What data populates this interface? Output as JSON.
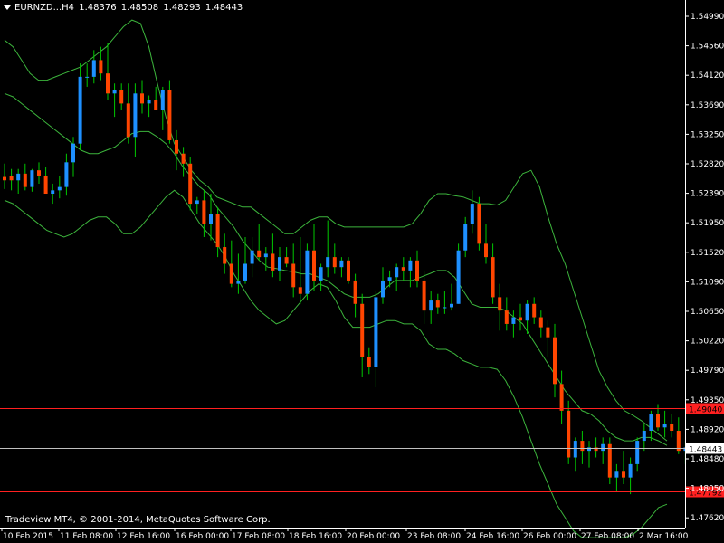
{
  "header": {
    "symbol": "EURNZD...H4",
    "open": "1.48376",
    "high": "1.48508",
    "low": "1.48293",
    "close": "1.48443"
  },
  "copyright": "Tradeview MT4, © 2001-2014, MetaQuotes Software Corp.",
  "colors": {
    "background": "#000000",
    "bull": "#1e90ff",
    "bear": "#ff4500",
    "wick": "#00c800",
    "bands": "#3cb43c",
    "hline": "#ff2020",
    "bidline": "#c0c0c0",
    "text": "#ffffff"
  },
  "chart_data": {
    "type": "candlestick",
    "ylim": [
      1.4725,
      1.5515
    ],
    "y_ticks": [
      "1.54990",
      "1.54560",
      "1.54120",
      "1.53690",
      "1.53250",
      "1.52820",
      "1.52390",
      "1.51950",
      "1.51520",
      "1.51090",
      "1.50650",
      "1.50220",
      "1.49790",
      "1.49350",
      "1.48920",
      "1.48480",
      "1.48050",
      "1.47620"
    ],
    "x_labels": [
      "10 Feb 2015",
      "11 Feb 08:00",
      "12 Feb 16:00",
      "16 Feb 00:00",
      "17 Feb 08:00",
      "18 Feb 16:00",
      "20 Feb 00:00",
      "23 Feb 08:00",
      "24 Feb 16:00",
      "26 Feb 00:00",
      "27 Feb 08:00",
      "2 Mar 16:00"
    ],
    "horizontal_levels": [
      {
        "price": 1.4904,
        "label": "1.49040",
        "color": "#ff2020"
      },
      {
        "price": 1.47792,
        "label": "1.47792",
        "color": "#ff2020"
      }
    ],
    "bid": {
      "price": 1.48443,
      "label": "1.48443"
    },
    "indicator": "Bollinger Bands",
    "bands": {
      "upper": [
        1.5455,
        1.5445,
        1.5425,
        1.5405,
        1.5395,
        1.5395,
        1.54,
        1.5405,
        1.541,
        1.5415,
        1.5425,
        1.5435,
        1.5445,
        1.546,
        1.5475,
        1.5485,
        1.548,
        1.5445,
        1.539,
        1.534,
        1.53,
        1.528,
        1.526,
        1.5245,
        1.5235,
        1.522,
        1.5215,
        1.521,
        1.5205,
        1.5205,
        1.5195,
        1.5185,
        1.5175,
        1.5165,
        1.5165,
        1.5175,
        1.5185,
        1.519,
        1.519,
        1.518,
        1.5175,
        1.5175,
        1.5175,
        1.5175,
        1.5175,
        1.5175,
        1.5175,
        1.5175,
        1.518,
        1.5195,
        1.5215,
        1.5225,
        1.5225,
        1.5222,
        1.522,
        1.5215,
        1.521,
        1.521,
        1.5208,
        1.5215,
        1.5235,
        1.5255,
        1.526,
        1.5235,
        1.519,
        1.515,
        1.512,
        1.508,
        1.504,
        1.5,
        1.496,
        1.4935,
        1.4915,
        1.49,
        1.4893,
        1.4885,
        1.4875,
        1.4865,
        1.4855
      ],
      "middle": [
        1.5375,
        1.537,
        1.536,
        1.535,
        1.534,
        1.533,
        1.532,
        1.531,
        1.53,
        1.529,
        1.5285,
        1.5285,
        1.529,
        1.5295,
        1.5305,
        1.5315,
        1.5318,
        1.5318,
        1.531,
        1.53,
        1.5285,
        1.5265,
        1.525,
        1.5235,
        1.5225,
        1.5205,
        1.519,
        1.5175,
        1.5155,
        1.514,
        1.5125,
        1.5115,
        1.5113,
        1.511,
        1.5108,
        1.5105,
        1.5105,
        1.51,
        1.5095,
        1.5085,
        1.5075,
        1.507,
        1.507,
        1.507,
        1.5075,
        1.5085,
        1.5095,
        1.5095,
        1.5095,
        1.51,
        1.5105,
        1.511,
        1.511,
        1.51,
        1.508,
        1.506,
        1.5055,
        1.5055,
        1.5055,
        1.505,
        1.504,
        1.503,
        1.501,
        1.499,
        1.497,
        1.495,
        1.493,
        1.4915,
        1.49,
        1.4895,
        1.4885,
        1.487,
        1.486,
        1.4855,
        1.4855,
        1.486,
        1.486,
        1.4855,
        1.4848
      ],
      "lower": [
        1.5215,
        1.521,
        1.52,
        1.519,
        1.518,
        1.517,
        1.5165,
        1.516,
        1.5165,
        1.5175,
        1.5185,
        1.519,
        1.519,
        1.518,
        1.5165,
        1.5165,
        1.5175,
        1.519,
        1.5205,
        1.522,
        1.523,
        1.522,
        1.52,
        1.518,
        1.5165,
        1.515,
        1.513,
        1.5105,
        1.5085,
        1.5065,
        1.505,
        1.504,
        1.503,
        1.5035,
        1.505,
        1.5065,
        1.508,
        1.509,
        1.5085,
        1.5065,
        1.504,
        1.5025,
        1.5025,
        1.5025,
        1.503,
        1.5035,
        1.5035,
        1.503,
        1.503,
        1.502,
        1.5,
        1.4992,
        1.4992,
        1.4985,
        1.4975,
        1.497,
        1.4965,
        1.4965,
        1.4962,
        1.4945,
        1.492,
        1.489,
        1.4855,
        1.482,
        1.479,
        1.476,
        1.474,
        1.472,
        1.471,
        1.471,
        1.471,
        1.471,
        1.471,
        1.471,
        1.4715,
        1.4725,
        1.474,
        1.4755,
        1.476
      ],
      "_note": "band values sampled uniformly across x"
    },
    "candles": [
      [
        1.525,
        1.527,
        1.5232,
        1.5245
      ],
      [
        1.5252,
        1.5262,
        1.523,
        1.5245
      ],
      [
        1.5245,
        1.5262,
        1.5225,
        1.5255
      ],
      [
        1.5255,
        1.527,
        1.523,
        1.5235
      ],
      [
        1.5235,
        1.5262,
        1.5228,
        1.526
      ],
      [
        1.526,
        1.5272,
        1.524,
        1.5252
      ],
      [
        1.5252,
        1.5265,
        1.5225,
        1.5225
      ],
      [
        1.5225,
        1.524,
        1.521,
        1.523
      ],
      [
        1.523,
        1.5252,
        1.5218,
        1.5235
      ],
      [
        1.5235,
        1.5285,
        1.5222,
        1.5272
      ],
      [
        1.5272,
        1.531,
        1.525,
        1.53
      ],
      [
        1.53,
        1.542,
        1.529,
        1.54
      ],
      [
        1.54,
        1.542,
        1.5385,
        1.54
      ],
      [
        1.54,
        1.544,
        1.539,
        1.5425
      ],
      [
        1.5425,
        1.5445,
        1.5395,
        1.5405
      ],
      [
        1.5405,
        1.545,
        1.5365,
        1.5375
      ],
      [
        1.5375,
        1.539,
        1.534,
        1.538
      ],
      [
        1.538,
        1.539,
        1.535,
        1.536
      ],
      [
        1.536,
        1.539,
        1.53,
        1.531
      ],
      [
        1.531,
        1.539,
        1.528,
        1.5375
      ],
      [
        1.5375,
        1.5395,
        1.5345,
        1.536
      ],
      [
        1.536,
        1.5372,
        1.534,
        1.5365
      ],
      [
        1.5365,
        1.5385,
        1.535,
        1.535
      ],
      [
        1.535,
        1.5385,
        1.532,
        1.538
      ],
      [
        1.538,
        1.5395,
        1.53,
        1.5305
      ],
      [
        1.5305,
        1.532,
        1.526,
        1.5285
      ],
      [
        1.5285,
        1.5295,
        1.525,
        1.527
      ],
      [
        1.527,
        1.528,
        1.52,
        1.521
      ],
      [
        1.521,
        1.522,
        1.5195,
        1.5215
      ],
      [
        1.5215,
        1.523,
        1.516,
        1.518
      ],
      [
        1.518,
        1.5225,
        1.5155,
        1.5195
      ],
      [
        1.5195,
        1.5205,
        1.513,
        1.5145
      ],
      [
        1.5145,
        1.5165,
        1.5105,
        1.512
      ],
      [
        1.512,
        1.5155,
        1.5085,
        1.509
      ],
      [
        1.509,
        1.5135,
        1.5075,
        1.5095
      ],
      [
        1.5095,
        1.516,
        1.509,
        1.512
      ],
      [
        1.512,
        1.516,
        1.51,
        1.514
      ],
      [
        1.514,
        1.518,
        1.5125,
        1.513
      ],
      [
        1.513,
        1.5145,
        1.511,
        1.5135
      ],
      [
        1.5135,
        1.5165,
        1.51,
        1.511
      ],
      [
        1.511,
        1.5145,
        1.5095,
        1.513
      ],
      [
        1.513,
        1.5145,
        1.5115,
        1.512
      ],
      [
        1.512,
        1.515,
        1.507,
        1.5085
      ],
      [
        1.5085,
        1.516,
        1.506,
        1.5075
      ],
      [
        1.5075,
        1.515,
        1.5065,
        1.514
      ],
      [
        1.514,
        1.518,
        1.508,
        1.5095
      ],
      [
        1.5095,
        1.512,
        1.508,
        1.5115
      ],
      [
        1.5115,
        1.5185,
        1.51,
        1.513
      ],
      [
        1.513,
        1.515,
        1.5105,
        1.5115
      ],
      [
        1.5115,
        1.513,
        1.51,
        1.5125
      ],
      [
        1.5125,
        1.513,
        1.509,
        1.5095
      ],
      [
        1.5095,
        1.5105,
        1.504,
        1.506
      ],
      [
        1.506,
        1.5075,
        1.495,
        1.498
      ],
      [
        1.498,
        1.4995,
        1.4955,
        1.4965
      ],
      [
        1.4965,
        1.508,
        1.4935,
        1.507
      ],
      [
        1.507,
        1.5115,
        1.506,
        1.5095
      ],
      [
        1.5095,
        1.511,
        1.5085,
        1.51
      ],
      [
        1.51,
        1.512,
        1.508,
        1.5115
      ],
      [
        1.5115,
        1.513,
        1.5095,
        1.511
      ],
      [
        1.511,
        1.513,
        1.5085,
        1.5125
      ],
      [
        1.5125,
        1.514,
        1.5085,
        1.5095
      ],
      [
        1.5095,
        1.511,
        1.503,
        1.505
      ],
      [
        1.505,
        1.508,
        1.503,
        1.5065
      ],
      [
        1.5065,
        1.5075,
        1.5045,
        1.5055
      ],
      [
        1.5055,
        1.508,
        1.5045,
        1.5055
      ],
      [
        1.5055,
        1.509,
        1.505,
        1.506
      ],
      [
        1.506,
        1.515,
        1.506,
        1.514
      ],
      [
        1.514,
        1.519,
        1.513,
        1.518
      ],
      [
        1.518,
        1.523,
        1.5165,
        1.521
      ],
      [
        1.521,
        1.522,
        1.514,
        1.515
      ],
      [
        1.515,
        1.518,
        1.512,
        1.513
      ],
      [
        1.513,
        1.515,
        1.506,
        1.507
      ],
      [
        1.507,
        1.509,
        1.502,
        1.505
      ],
      [
        1.505,
        1.507,
        1.502,
        1.503
      ],
      [
        1.503,
        1.505,
        1.501,
        1.504
      ],
      [
        1.504,
        1.506,
        1.502,
        1.5035
      ],
      [
        1.5035,
        1.5065,
        1.5015,
        1.506
      ],
      [
        1.506,
        1.507,
        1.503,
        1.504
      ],
      [
        1.504,
        1.505,
        1.501,
        1.5025
      ],
      [
        1.5025,
        1.5035,
        1.498,
        1.501
      ],
      [
        1.501,
        1.503,
        1.492,
        1.494
      ],
      [
        1.494,
        1.496,
        1.488,
        1.49
      ],
      [
        1.49,
        1.4915,
        1.482,
        1.483
      ],
      [
        1.483,
        1.486,
        1.481,
        1.4855
      ],
      [
        1.4855,
        1.487,
        1.482,
        1.484
      ],
      [
        1.484,
        1.4855,
        1.4815,
        1.4845
      ],
      [
        1.4845,
        1.486,
        1.483,
        1.484
      ],
      [
        1.484,
        1.486,
        1.482,
        1.485
      ],
      [
        1.485,
        1.486,
        1.479,
        1.48
      ],
      [
        1.48,
        1.482,
        1.478,
        1.481
      ],
      [
        1.481,
        1.484,
        1.479,
        1.48
      ],
      [
        1.48,
        1.483,
        1.4775,
        1.482
      ],
      [
        1.482,
        1.486,
        1.481,
        1.4855
      ],
      [
        1.4855,
        1.488,
        1.484,
        1.487
      ],
      [
        1.487,
        1.49,
        1.4855,
        1.4895
      ],
      [
        1.4895,
        1.491,
        1.487,
        1.4875
      ],
      [
        1.4875,
        1.49,
        1.486,
        1.488
      ],
      [
        1.488,
        1.4895,
        1.486,
        1.487
      ],
      [
        1.487,
        1.489,
        1.4835,
        1.484
      ],
      [
        1.484,
        1.4855,
        1.482,
        1.4845
      ]
    ]
  }
}
